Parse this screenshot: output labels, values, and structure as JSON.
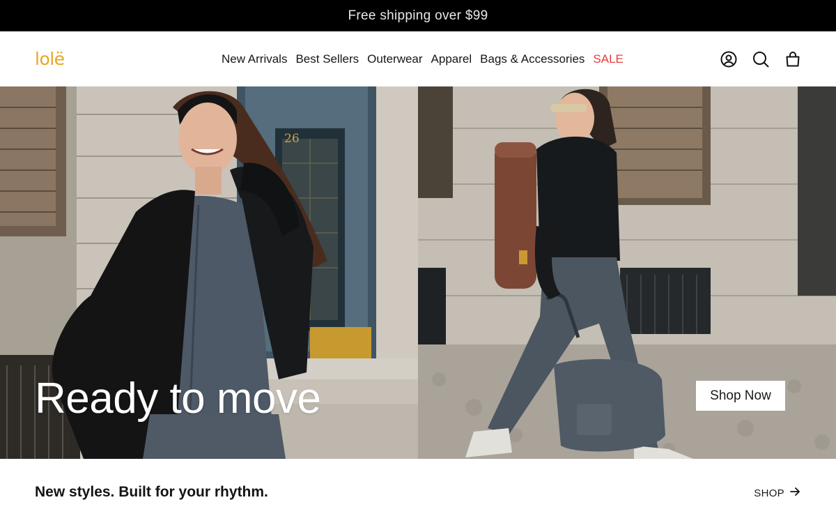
{
  "announcement": {
    "text": "Free shipping over $99"
  },
  "header": {
    "logo_text": "lolë",
    "nav": [
      {
        "label": "New Arrivals"
      },
      {
        "label": "Best Sellers"
      },
      {
        "label": "Outerwear"
      },
      {
        "label": "Apparel"
      },
      {
        "label": "Bags & Accessories"
      },
      {
        "label": "SALE"
      }
    ],
    "icons": [
      "account-icon",
      "search-icon",
      "cart-icon"
    ]
  },
  "hero": {
    "title": "Ready to move",
    "cta_label": "Shop Now",
    "door_number": "26"
  },
  "section": {
    "tagline": "New styles. Built for your rhythm.",
    "link_label": "SHOP"
  },
  "colors": {
    "announcement_bg": "#000000",
    "logo": "#e8a623",
    "sale": "#e53c3c",
    "text": "#161616"
  }
}
